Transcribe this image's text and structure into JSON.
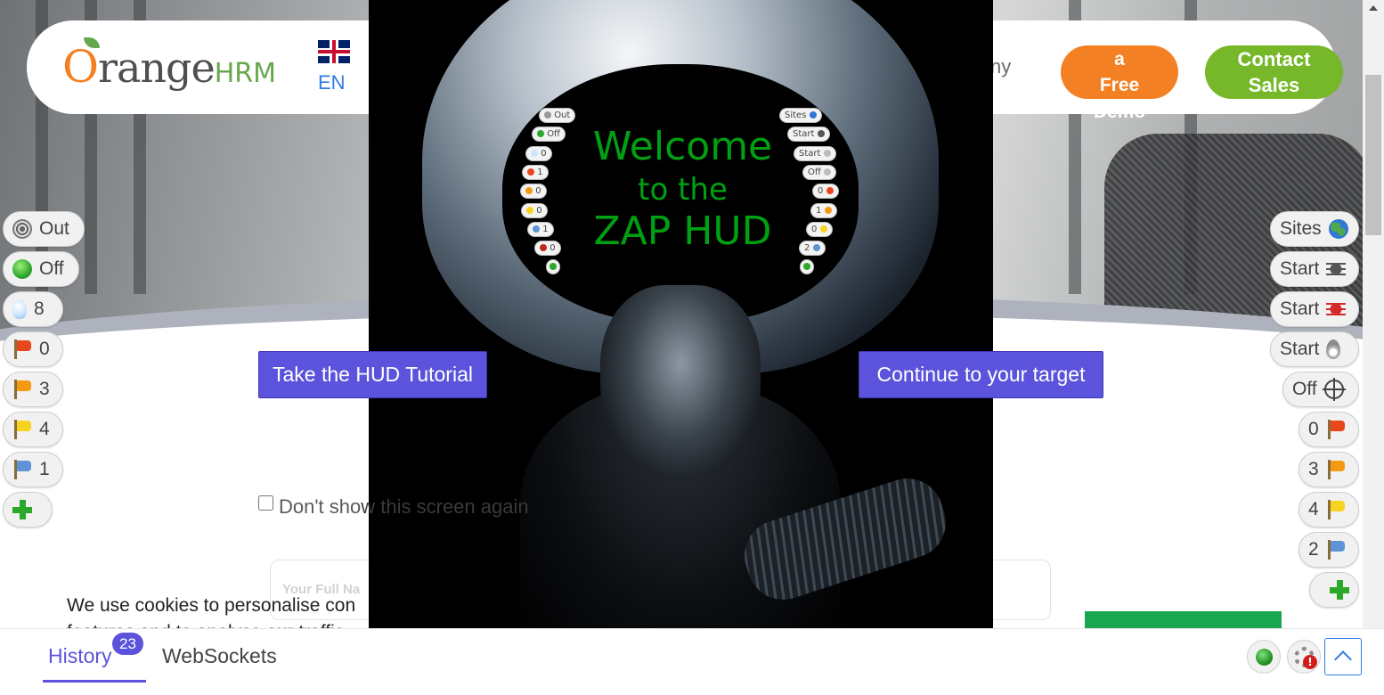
{
  "site": {
    "logo": {
      "orange": "O",
      "range": "range",
      "hrm": "HRM"
    },
    "language": "EN",
    "nav_partial": "ny",
    "demo_button": {
      "line1": "a",
      "line2": "Free",
      "overflow": "Demo"
    },
    "contact_button": {
      "line1": "Contact",
      "line2": "Sales"
    },
    "form_placeholder": "Your Full Na",
    "cookie_line1": "We use cookies to personalise con",
    "cookie_line2": "features and to analyse our traffic"
  },
  "splash": {
    "welcome_line1": "Welcome",
    "welcome_line2": "to the",
    "welcome_line3": "ZAP HUD",
    "tutorial_button": "Take the HUD Tutorial",
    "continue_button": "Continue to your target",
    "dont_show_part1": "Don't sho",
    "dont_show_part2": "w this screen again",
    "mini_left": [
      "Out",
      "Off",
      "0",
      "1",
      "0",
      "0",
      "1",
      "0"
    ],
    "mini_right": [
      "Sites",
      "Start",
      "Start",
      "Off",
      "0",
      "1",
      "0",
      "2"
    ]
  },
  "hud_left": [
    {
      "label": "Out",
      "icon": "target-icon"
    },
    {
      "label": "Off",
      "icon": "green-dot-icon"
    },
    {
      "label": "8",
      "icon": "lightbulb-icon"
    },
    {
      "label": "0",
      "icon": "red-flag-icon",
      "color": "#e8471c"
    },
    {
      "label": "3",
      "icon": "orange-flag-icon",
      "color": "#f39a12"
    },
    {
      "label": "4",
      "icon": "yellow-flag-icon",
      "color": "#f5d421"
    },
    {
      "label": "1",
      "icon": "blue-flag-icon",
      "color": "#5e94d6"
    },
    {
      "label": "",
      "icon": "plus-icon"
    }
  ],
  "hud_right": [
    {
      "label": "Sites",
      "icon": "globe-icon"
    },
    {
      "label": "Start",
      "icon": "spider-icon",
      "color": "#555555"
    },
    {
      "label": "Start",
      "icon": "ajax-spider-icon",
      "color": "#d42a2a"
    },
    {
      "label": "Start",
      "icon": "flame-icon"
    },
    {
      "label": "Off",
      "icon": "crosshair-icon"
    },
    {
      "label": "0",
      "icon": "red-flag-icon",
      "color": "#e8471c"
    },
    {
      "label": "3",
      "icon": "orange-flag-icon",
      "color": "#f39a12"
    },
    {
      "label": "4",
      "icon": "yellow-flag-icon",
      "color": "#f5d421"
    },
    {
      "label": "2",
      "icon": "blue-flag-icon",
      "color": "#5e94d6"
    },
    {
      "label": "",
      "icon": "plus-icon"
    }
  ],
  "drawer": {
    "history_tab": "History",
    "history_count": "23",
    "websockets_tab": "WebSockets"
  },
  "colors": {
    "accent": "#5b53db",
    "orange": "#f48024",
    "green": "#76b82a",
    "zap_green": "#00a012"
  }
}
